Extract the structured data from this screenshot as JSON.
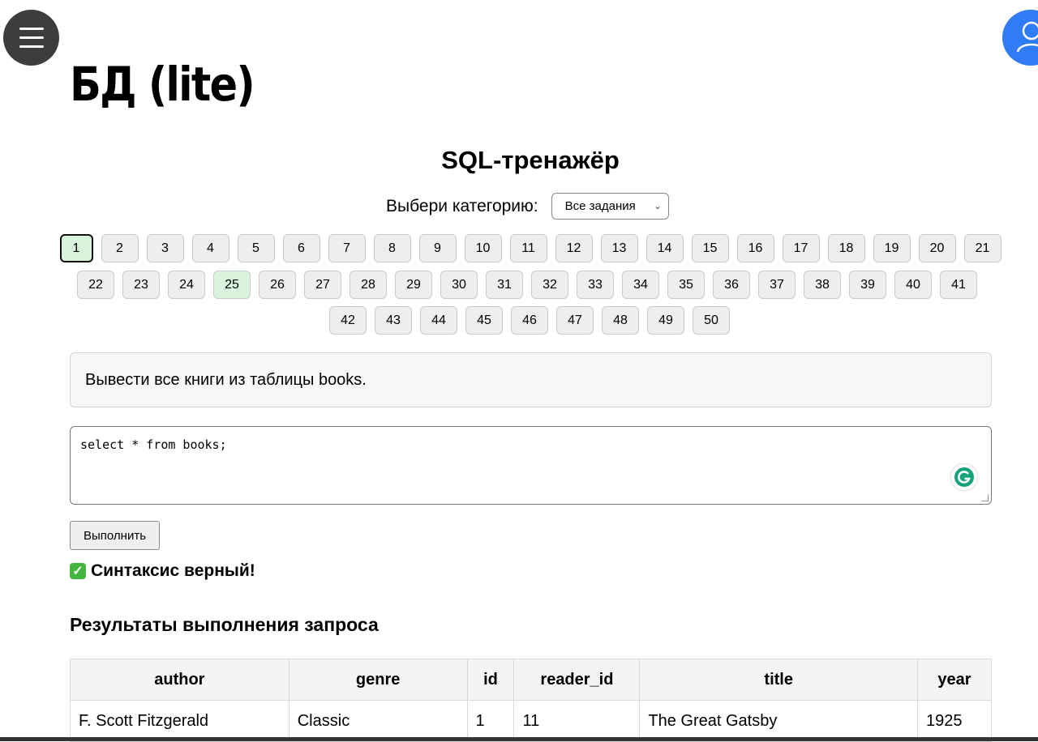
{
  "page_title": "БД (lite)",
  "trainer_title": "SQL-тренажёр",
  "category": {
    "label": "Выбери категорию:",
    "selected": "Все задания"
  },
  "tasks": {
    "row1": [
      "1",
      "2",
      "3",
      "4",
      "5",
      "6",
      "7",
      "8",
      "9",
      "10",
      "11",
      "12",
      "13",
      "14",
      "15",
      "16",
      "17",
      "18",
      "19",
      "20",
      "21"
    ],
    "row2": [
      "22",
      "23",
      "24",
      "25",
      "26",
      "27",
      "28",
      "29",
      "30",
      "31",
      "32",
      "33",
      "34",
      "35",
      "36",
      "37",
      "38",
      "39",
      "40",
      "41"
    ],
    "row3": [
      "42",
      "43",
      "44",
      "45",
      "46",
      "47",
      "48",
      "49",
      "50"
    ],
    "active": "1",
    "completed": [
      "1",
      "25"
    ]
  },
  "task_text": "Вывести все книги из таблицы books.",
  "sql_input": "select * from books;",
  "run_button": "Выполнить",
  "syntax_message": "Синтаксис верный!",
  "results": {
    "title": "Результаты выполнения запроса",
    "columns": [
      "author",
      "genre",
      "id",
      "reader_id",
      "title",
      "year"
    ],
    "rows": [
      [
        "F. Scott Fitzgerald",
        "Classic",
        "1",
        "11",
        "The Great Gatsby",
        "1925"
      ]
    ]
  },
  "icons": {
    "menu": "menu-icon",
    "profile": "user-icon",
    "grammarly": "grammarly-icon",
    "check": "check-icon"
  },
  "colors": {
    "profile_bg": "#2f7cf6",
    "completed_bg": "#d9f3dd",
    "menu_bg": "#3d3d3d"
  }
}
